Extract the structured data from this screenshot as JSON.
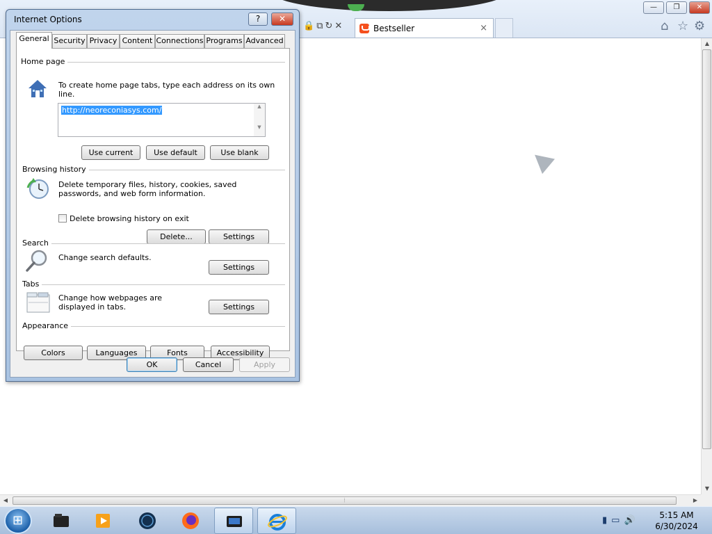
{
  "browser": {
    "tab_title": "Bestseller",
    "tab_close": "×",
    "window_controls": {
      "minimize": "—",
      "restore": "❐",
      "close": "✕"
    },
    "toolbar_icons": [
      "home-icon",
      "star-icon",
      "gear-icon"
    ]
  },
  "dialog": {
    "title": "Internet Options",
    "help_label": "?",
    "close_label": "✕",
    "tabs": [
      "General",
      "Security",
      "Privacy",
      "Content",
      "Connections",
      "Programs",
      "Advanced"
    ],
    "selected_tab": "General",
    "home_page": {
      "label": "Home page",
      "description": "To create home page tabs, type each address on its own line.",
      "url": "http://neoreconiasys.com/",
      "use_current": "Use current",
      "use_default": "Use default",
      "use_blank": "Use blank"
    },
    "browsing_history": {
      "label": "Browsing history",
      "description": "Delete temporary files, history, cookies, saved passwords, and web form information.",
      "checkbox_label": "Delete browsing history on exit",
      "checkbox_checked": false,
      "delete": "Delete...",
      "settings": "Settings"
    },
    "search": {
      "label": "Search",
      "description": "Change search defaults.",
      "settings": "Settings"
    },
    "tabs_section": {
      "label": "Tabs",
      "description": "Change how webpages are displayed in tabs.",
      "settings": "Settings"
    },
    "appearance": {
      "label": "Appearance",
      "colors": "Colors",
      "languages": "Languages",
      "fonts": "Fonts",
      "accessibility": "Accessibility"
    },
    "ok": "OK",
    "cancel": "Cancel",
    "apply": "Apply"
  },
  "taskbar": {
    "time": "5:15 AM",
    "date": "6/30/2024"
  },
  "colors": {
    "dialog_frame": "#a9c3e2",
    "close_red": "#c8381f",
    "selection_blue": "#3399ff",
    "bestseller_orange": "#f5501e"
  }
}
